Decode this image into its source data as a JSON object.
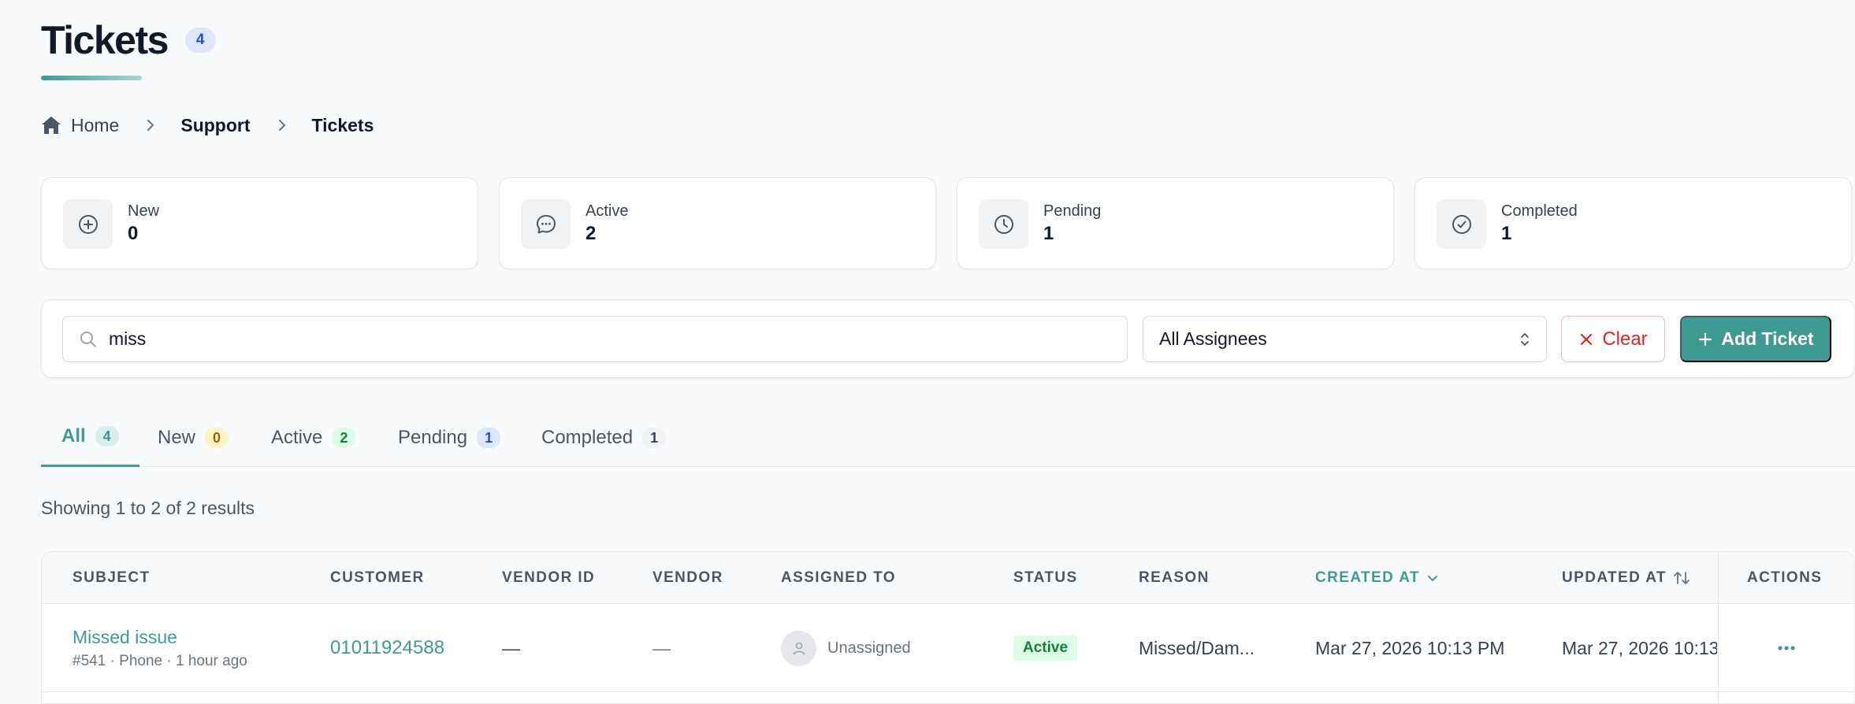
{
  "header": {
    "title": "Tickets",
    "count": "4"
  },
  "breadcrumb": {
    "home": "Home",
    "section": "Support",
    "current": "Tickets"
  },
  "stats": [
    {
      "label": "New",
      "value": "0",
      "icon": "plus-circle-icon"
    },
    {
      "label": "Active",
      "value": "2",
      "icon": "chat-bubble-icon"
    },
    {
      "label": "Pending",
      "value": "1",
      "icon": "clock-icon"
    },
    {
      "label": "Completed",
      "value": "1",
      "icon": "check-circle-icon"
    }
  ],
  "filters": {
    "search_value": "miss",
    "assignee_selected": "All Assignees",
    "clear_label": "Clear",
    "add_label": "Add Ticket"
  },
  "tabs": [
    {
      "label": "All",
      "count": "4"
    },
    {
      "label": "New",
      "count": "0"
    },
    {
      "label": "Active",
      "count": "2"
    },
    {
      "label": "Pending",
      "count": "1"
    },
    {
      "label": "Completed",
      "count": "1"
    }
  ],
  "results_text": "Showing 1 to 2 of 2 results",
  "table": {
    "columns": {
      "subject": "Subject",
      "customer": "Customer",
      "vendor_id": "Vendor ID",
      "vendor": "Vendor",
      "assigned_to": "Assigned To",
      "status": "Status",
      "reason": "Reason",
      "created_at": "Created At",
      "updated_at": "Updated At",
      "actions": "Actions"
    },
    "rows": [
      {
        "subject": "Missed issue",
        "ticket_no": "#541",
        "channel": "Phone",
        "age": "1 hour ago",
        "customer": "01011924588",
        "vendor_id": "—",
        "vendor": "—",
        "assigned_to": "Unassigned",
        "status": "Active",
        "reason": "Missed/Dam...",
        "created_at": "Mar 27, 2026 10:13 PM",
        "updated_at": "Mar 27, 2026 10:13"
      }
    ]
  },
  "colors": {
    "accent": "#3e9a93",
    "danger": "#dc2626",
    "status_active_bg": "#dcfce7",
    "status_active_text": "#15803d"
  }
}
